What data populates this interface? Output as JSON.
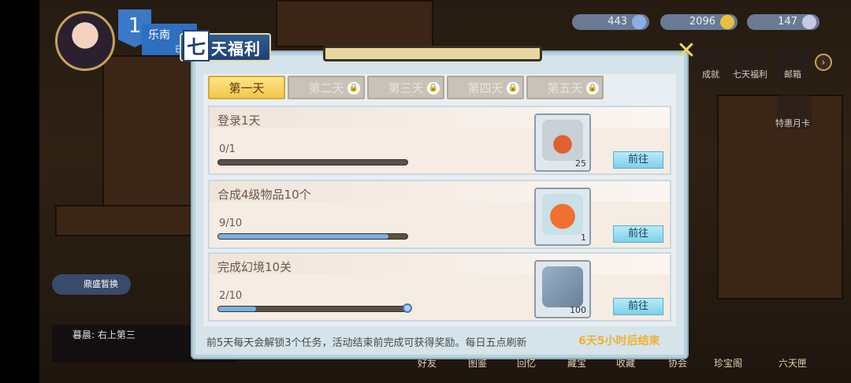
{
  "hud": {
    "level": "1",
    "player_name": "乐南",
    "player_sub": "已拥",
    "currencies": [
      {
        "value": "443",
        "color": "#8ab0e8"
      },
      {
        "value": "2096",
        "color": "#e8c040"
      },
      {
        "value": "147",
        "color": "#c8c8e8"
      }
    ],
    "menu_icons": [
      {
        "label": "成就",
        "icon": "trophy-icon"
      },
      {
        "label": "七天福利",
        "icon": "gift-icon"
      },
      {
        "label": "邮箱",
        "icon": "mail-icon"
      }
    ],
    "special_card_label": "特惠月卡",
    "arrow": "›",
    "chat_bubble": "鼎盛暂换",
    "chat_line": "暮晨: 右上第三",
    "bottom_tabs": [
      "好友",
      "图鉴",
      "回忆",
      "藏宝",
      "收藏",
      "协会",
      "珍宝阁",
      "六天匣"
    ]
  },
  "modal": {
    "title_char": "七",
    "title_rest": "天福利",
    "close": "✕",
    "day_tabs": [
      {
        "label": "第一天",
        "active": true
      },
      {
        "label": "第二天",
        "active": false
      },
      {
        "label": "第三天",
        "active": false
      },
      {
        "label": "第四天",
        "active": false
      },
      {
        "label": "第五天",
        "active": false
      }
    ],
    "tasks": [
      {
        "title": "登录1天",
        "progress_text": "0/1",
        "progress": 0,
        "reward_count": "25",
        "reward_icon": "star-bottle-icon",
        "button": "前往"
      },
      {
        "title": "合成4级物品10个",
        "progress_text": "9/10",
        "progress": 0.9,
        "reward_count": "1",
        "reward_icon": "pumpkin-icon",
        "button": "前往"
      },
      {
        "title": "完成幻境10关",
        "progress_text": "2/10",
        "progress": 0.2,
        "reward_count": "100",
        "reward_icon": "silver-coins-icon",
        "button": "前往"
      }
    ],
    "note": "前5天每天会解锁3个任务，活动结束前完成可获得奖励。每日五点刷新",
    "timer": "6天5小时后结束"
  }
}
